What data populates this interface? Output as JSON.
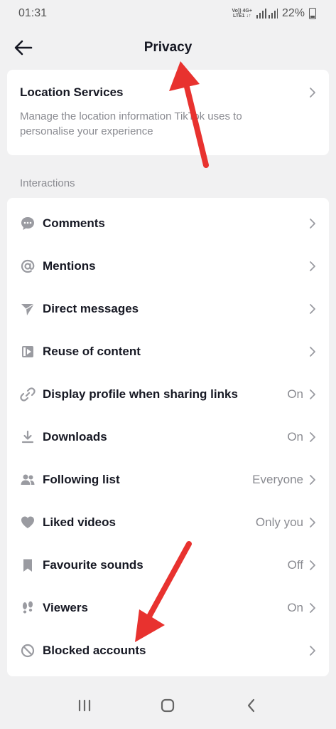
{
  "status_bar": {
    "time": "01:31",
    "net_top": "Vo)) 4G+",
    "net_bottom": "LTE1 ↓↑",
    "battery": "22%"
  },
  "header": {
    "title": "Privacy"
  },
  "location": {
    "title": "Location Services",
    "description": "Manage the location information TikTok uses to personalise your experience"
  },
  "section_label": "Interactions",
  "rows": [
    {
      "label": "Comments",
      "value": ""
    },
    {
      "label": "Mentions",
      "value": ""
    },
    {
      "label": "Direct messages",
      "value": ""
    },
    {
      "label": "Reuse of content",
      "value": ""
    },
    {
      "label": "Display profile when sharing links",
      "value": "On"
    },
    {
      "label": "Downloads",
      "value": "On"
    },
    {
      "label": "Following list",
      "value": "Everyone"
    },
    {
      "label": "Liked videos",
      "value": "Only you"
    },
    {
      "label": "Favourite sounds",
      "value": "Off"
    },
    {
      "label": "Viewers",
      "value": "On"
    },
    {
      "label": "Blocked accounts",
      "value": ""
    }
  ],
  "icons": [
    "comment-icon",
    "at-icon",
    "send-icon",
    "reuse-icon",
    "link-icon",
    "download-icon",
    "people-icon",
    "heart-icon",
    "bookmark-icon",
    "footprints-icon",
    "block-icon"
  ],
  "colors": {
    "annotation_arrow": "#e8322f",
    "text_primary": "#161823",
    "text_secondary": "#8a8b91"
  }
}
